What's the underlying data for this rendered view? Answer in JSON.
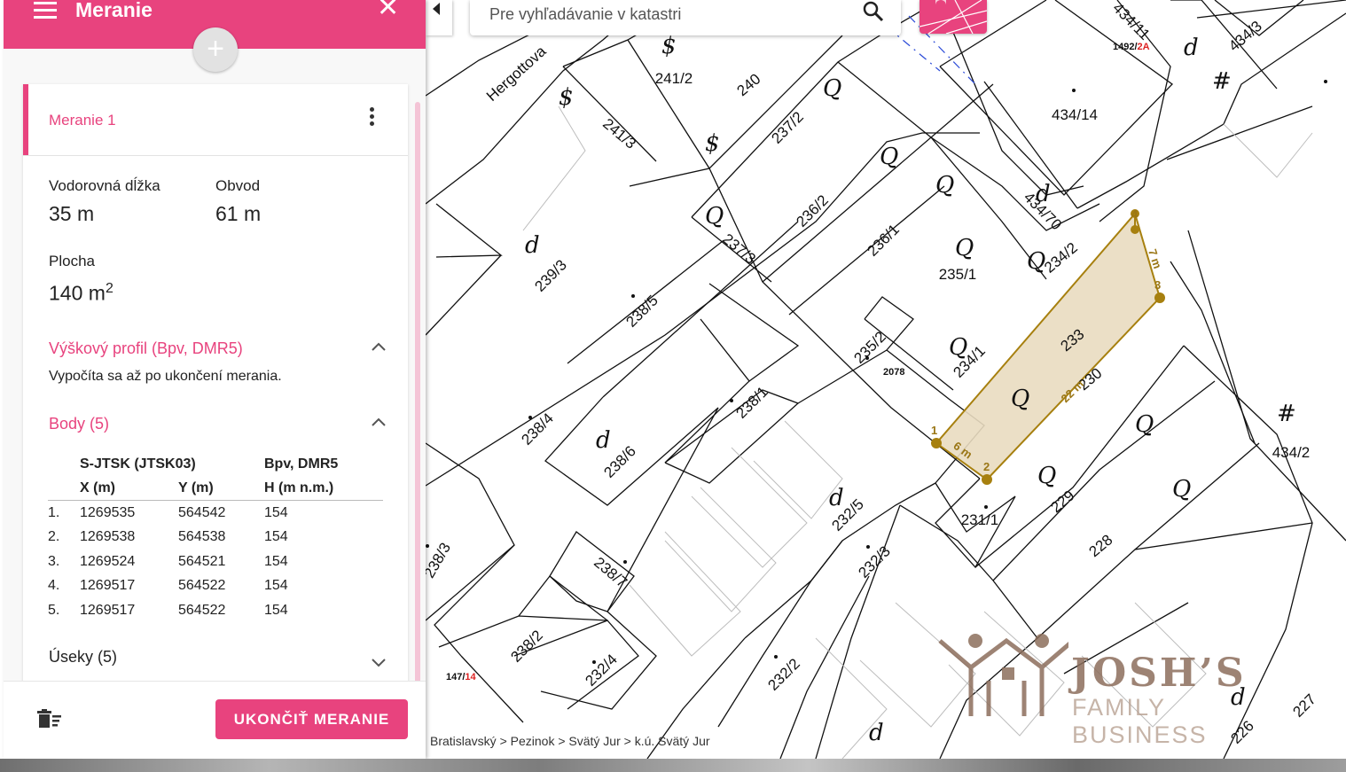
{
  "panel": {
    "title": "Meranie",
    "measurement_name": "Meranie 1",
    "horizontal_length_label": "Vodorovná dĺžka",
    "horizontal_length_value": "35 m",
    "perimeter_label": "Obvod",
    "perimeter_value": "61 m",
    "area_label": "Plocha",
    "area_value": "140 m",
    "area_unit_exp": "2",
    "elevation_section": "Výškový profil (Bpv, DMR5)",
    "elevation_note": "Vypočíta sa až po ukončení merania.",
    "points_section": "Body (5)",
    "segments_section": "Úseky (5)",
    "finish_button": "UKONČIŤ MERANIE",
    "table": {
      "crs_header": "S-JTSK (JTSK03)",
      "height_header": "Bpv, DMR5",
      "col_x": "X (m)",
      "col_y": "Y (m)",
      "col_h": "H (m n.m.)",
      "rows": [
        {
          "n": "1.",
          "x": "1269535",
          "y": "564542",
          "h": "154"
        },
        {
          "n": "2.",
          "x": "1269538",
          "y": "564538",
          "h": "154"
        },
        {
          "n": "3.",
          "x": "1269524",
          "y": "564521",
          "h": "154"
        },
        {
          "n": "4.",
          "x": "1269517",
          "y": "564522",
          "h": "154"
        },
        {
          "n": "5.",
          "x": "1269517",
          "y": "564522",
          "h": "154"
        }
      ]
    }
  },
  "search": {
    "placeholder": "Pre vyhľadávanie v katastri"
  },
  "breadcrumb": "Bratislavský > Pezinok > Svätý Jur > k.ú. Svätý Jur",
  "watermark": {
    "title": "JOSH’S",
    "subtitle": "FAMILY BUSINESS"
  },
  "map": {
    "street": "Hergottova",
    "parcels": [
      "241/2",
      "240",
      "241/3",
      "237/2",
      "236/2",
      "236/1",
      "235/1",
      "234/2",
      "239/3",
      "237/3",
      "238/5",
      "235/2",
      "234/1",
      "233",
      "230",
      "238/4",
      "238/1",
      "238/6",
      "229",
      "228",
      "232/5",
      "231/1",
      "238/3",
      "238/7",
      "232/3",
      "238/2",
      "232/4",
      "232/2",
      "434/14",
      "434/70",
      "434/11",
      "434/3",
      "434/2",
      "227",
      "226"
    ],
    "refs": [
      {
        "num": "1492",
        "sub": "2A"
      },
      {
        "num": "147",
        "sub": "14"
      },
      {
        "num": "2078",
        "sub": ""
      }
    ],
    "segments": [
      "6 m",
      "22 m",
      "7 m",
      "0 m"
    ],
    "vertices": [
      "1",
      "2",
      "3",
      "4"
    ],
    "polygon_fill": "#e9dcc0",
    "polygon_stroke": "#a7800f",
    "accent": "#e8437e"
  }
}
